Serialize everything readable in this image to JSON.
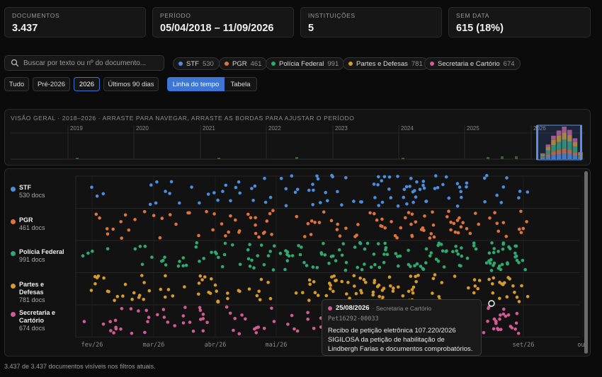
{
  "stats": [
    {
      "label": "DOCUMENTOS",
      "value": "3.437"
    },
    {
      "label": "PERÍODO",
      "value": "05/04/2018 – 11/09/2026"
    },
    {
      "label": "INSTITUIÇÕES",
      "value": "5"
    },
    {
      "label": "SEM DATA",
      "value": "615 (18%)"
    }
  ],
  "search": {
    "placeholder": "Buscar por texto ou nº do documento..."
  },
  "institutions": [
    {
      "name": "STF",
      "count": "530",
      "docs": "530 docs",
      "color": "#4a8ee0"
    },
    {
      "name": "PGR",
      "count": "461",
      "docs": "461 docs",
      "color": "#e0733a"
    },
    {
      "name": "Polícia Federal",
      "count": "991",
      "docs": "991 docs",
      "color": "#2fa872"
    },
    {
      "name": "Partes e Defesas",
      "count": "781",
      "docs": "781 docs",
      "color": "#d89a2a"
    },
    {
      "name": "Secretaria e Cartório",
      "count": "674",
      "docs": "674 docs",
      "color": "#d35a96"
    }
  ],
  "period_filters": [
    {
      "label": "Tudo",
      "active": false
    },
    {
      "label": "Pré-2026",
      "active": false
    },
    {
      "label": "2026",
      "active": true
    },
    {
      "label": "Últimos 90 dias",
      "active": false
    }
  ],
  "views": {
    "timeline": "Linha do tempo",
    "table": "Tabela"
  },
  "overview": {
    "title": "VISÃO GERAL · 2018–2026 · ARRASTE PARA NAVEGAR, ARRASTE AS BORDAS PARA AJUSTAR O PERÍODO",
    "years": [
      "2019",
      "2020",
      "2021",
      "2022",
      "2023",
      "2024",
      "2025",
      "2026"
    ],
    "histogram_levels": [
      0.18,
      0.45,
      0.72,
      0.88,
      1.0,
      0.9,
      0.64,
      0.22
    ]
  },
  "timeline": {
    "months": [
      "fev/26",
      "mar/26",
      "abr/26",
      "mai/26",
      "set/26",
      "out"
    ]
  },
  "tooltip": {
    "date": "25/08/2026",
    "source": "· Secretaria e Cartório",
    "id": "Pet16292-00033",
    "text": "Recibo de petição eletrônica 107.220/2026 SIGILOSA da petição de habilitação de Lindbergh Farias e documentos comprobatórios."
  },
  "footer": "3.437 de 3.437 documentos visíveis nos filtros atuais."
}
